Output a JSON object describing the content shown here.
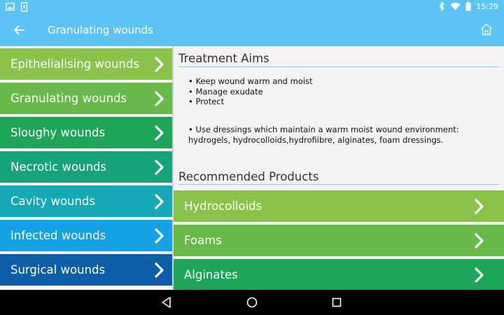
{
  "status_bar": {
    "time": "15:29",
    "icons": [
      "image-notification-icon",
      "phone-notification-icon",
      "bluetooth-icon",
      "wifi-icon",
      "battery-icon"
    ]
  },
  "app_bar": {
    "title": "Granulating wounds",
    "back_icon": "arrow-left-icon",
    "home_icon": "home-icon"
  },
  "sidebar": {
    "items": [
      {
        "label": "Epithelialising wounds",
        "color": "#8bc34a"
      },
      {
        "label": "Granulating wounds",
        "color": "#69b94a"
      },
      {
        "label": "Sloughy wounds",
        "color": "#1fa55a"
      },
      {
        "label": "Necrotic wounds",
        "color": "#16a37a"
      },
      {
        "label": "Cavity wounds",
        "color": "#14a9b4"
      },
      {
        "label": "Infected wounds",
        "color": "#14a1e6"
      },
      {
        "label": "Surgical wounds",
        "color": "#0d5ea8"
      }
    ]
  },
  "main": {
    "treatment_title": "Treatment Aims",
    "aims": [
      "Keep wound warm and moist",
      "Manage exudate",
      "Protect"
    ],
    "note": "Use dressings which maintain a warm moist wound environment: hydrogels, hydrocolloids,hydrofiibre, alginates, foam dressings.",
    "products_title": "Recommended Products",
    "products": [
      {
        "label": "Hydrocolloids",
        "color": "#8bc34a"
      },
      {
        "label": "Foams",
        "color": "#69b94a"
      },
      {
        "label": "Alginates",
        "color": "#1fa55a"
      }
    ]
  },
  "nav_bar": {
    "icons": [
      "back-triangle-icon",
      "home-circle-icon",
      "recents-square-icon"
    ]
  }
}
